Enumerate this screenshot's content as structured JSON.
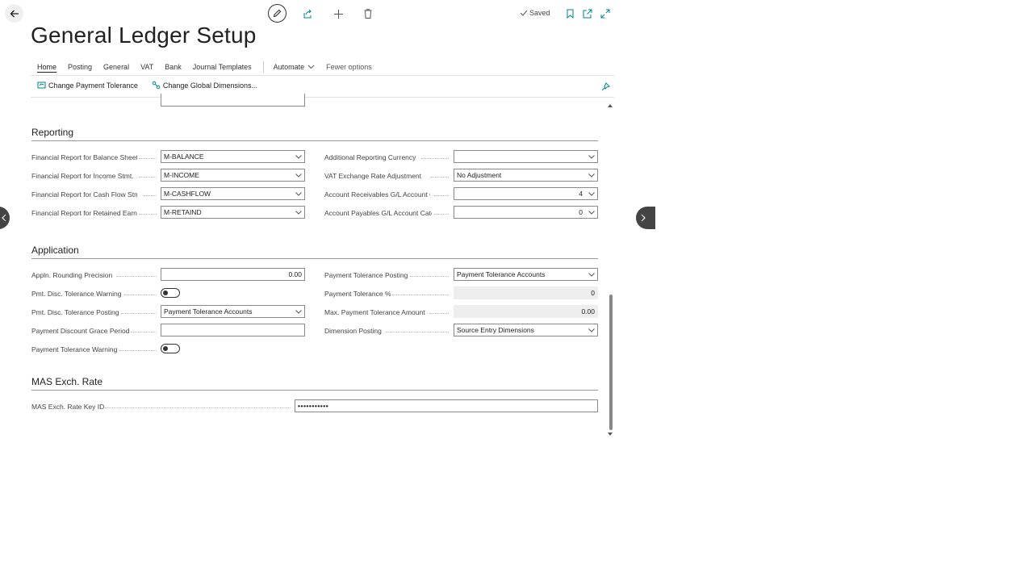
{
  "header": {
    "saved_label": "Saved",
    "title": "General Ledger Setup"
  },
  "tabs": [
    "Home",
    "Posting",
    "General",
    "VAT",
    "Bank",
    "Journal Templates"
  ],
  "tabs_more": {
    "automate": "Automate",
    "fewer": "Fewer options"
  },
  "actions": {
    "change_payment_tolerance": "Change Payment Tolerance",
    "change_global_dimensions": "Change Global Dimensions..."
  },
  "reporting": {
    "title": "Reporting",
    "left": [
      {
        "label": "Financial Report for Balance Sheet",
        "value": "M-BALANCE"
      },
      {
        "label": "Financial Report for Income Stmt.",
        "value": "M-INCOME"
      },
      {
        "label": "Financial Report for Cash Flow Stmt.",
        "value": "M-CASHFLOW"
      },
      {
        "label": "Financial Report for Retained Earn.",
        "value": "M-RETAIND"
      }
    ],
    "right": [
      {
        "label": "Additional Reporting Currency",
        "value": ""
      },
      {
        "label": "VAT Exchange Rate Adjustment",
        "value": "No Adjustment"
      },
      {
        "label": "Account Receivables G/L Account Category",
        "value": "4"
      },
      {
        "label": "Account Payables G/L Account Category",
        "value": "0"
      }
    ]
  },
  "application": {
    "title": "Application",
    "left": [
      {
        "label": "Appln. Rounding Precision",
        "value": "0.00"
      },
      {
        "label": "Pmt. Disc. Tolerance Warning",
        "toggle": false
      },
      {
        "label": "Pmt. Disc. Tolerance Posting",
        "value": "Payment Tolerance Accounts"
      },
      {
        "label": "Payment Discount Grace Period",
        "value": ""
      },
      {
        "label": "Payment Tolerance Warning",
        "toggle": false
      }
    ],
    "right": [
      {
        "label": "Payment Tolerance Posting",
        "value": "Payment Tolerance Accounts"
      },
      {
        "label": "Payment Tolerance %",
        "value": "0"
      },
      {
        "label": "Max. Payment Tolerance Amount",
        "value": "0.00"
      },
      {
        "label": "Dimension Posting",
        "value": "Source Entry Dimensions"
      }
    ]
  },
  "mas": {
    "title": "MAS Exch. Rate",
    "key_label": "MAS Exch. Rate Key ID",
    "key_value": "•••••••••••"
  },
  "colors": {
    "accent": "#008489",
    "text": "#212121",
    "border": "#8a8a8a"
  }
}
